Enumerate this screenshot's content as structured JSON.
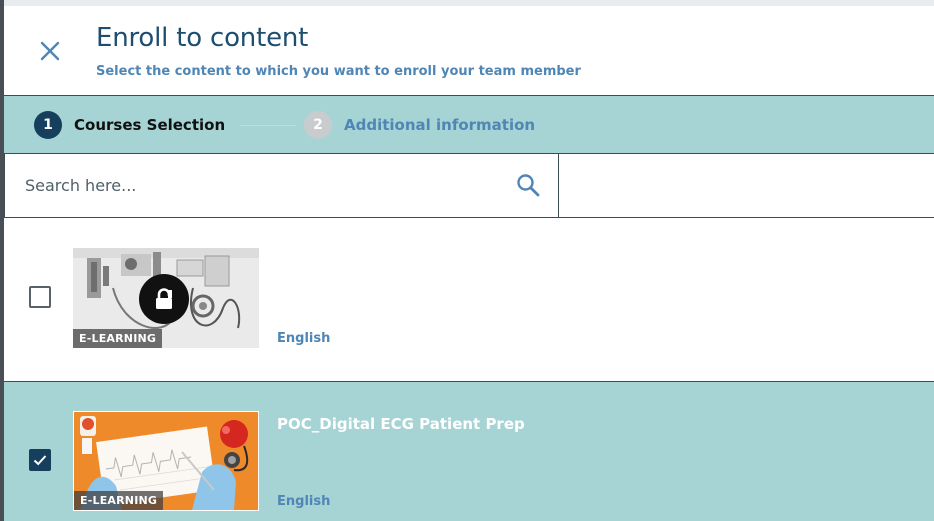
{
  "dialog": {
    "title": "Enroll to content",
    "subtitle": "Select the content to which you want to enroll your team member"
  },
  "stepper": {
    "steps": [
      {
        "number": "1",
        "label": "Courses Selection",
        "state": "active"
      },
      {
        "number": "2",
        "label": "Additional information",
        "state": "inactive"
      }
    ]
  },
  "search": {
    "placeholder": "Search here...",
    "value": ""
  },
  "courses": [
    {
      "title": "",
      "type_badge": "E-LEARNING",
      "language": "English",
      "selected": false,
      "locked": true,
      "thumbnail": "medical-wall-equipment-grayscale"
    },
    {
      "title": "POC_Digital ECG Patient Prep",
      "type_badge": "E-LEARNING",
      "language": "English",
      "selected": true,
      "locked": false,
      "thumbnail": "ecg-paper-with-stethoscope-orange"
    }
  ],
  "colors": {
    "primary_dark": "#153f5c",
    "accent_blue": "#4f86b5",
    "teal_band": "#a6d3d4",
    "title_blue": "#1d4e70"
  },
  "icons": {
    "close": "close-icon",
    "search": "search-icon",
    "lock": "lock-icon",
    "check": "checkmark-icon"
  }
}
